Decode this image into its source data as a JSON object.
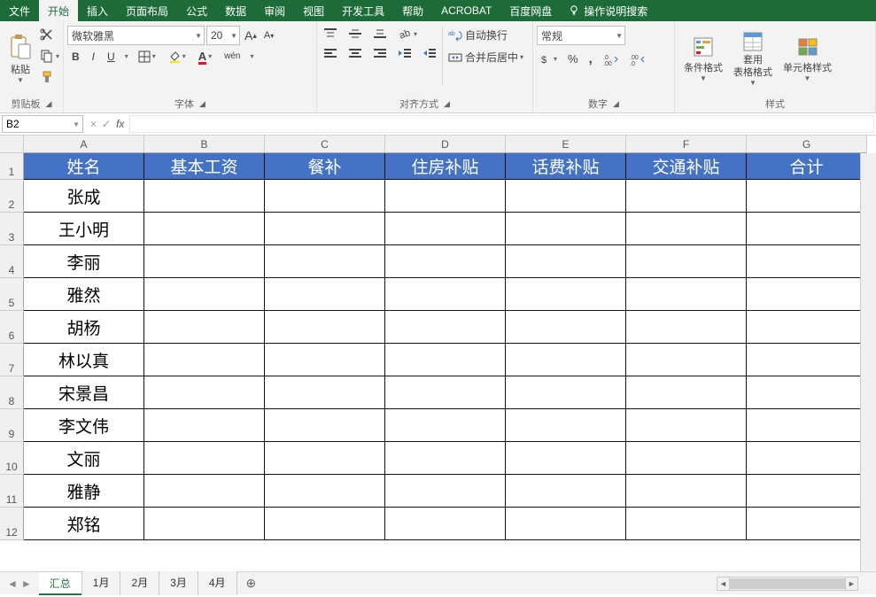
{
  "menu": {
    "tabs": [
      "文件",
      "开始",
      "插入",
      "页面布局",
      "公式",
      "数据",
      "审阅",
      "视图",
      "开发工具",
      "帮助",
      "ACROBAT",
      "百度网盘"
    ],
    "active_index": 1,
    "tell_me": "操作说明搜索"
  },
  "ribbon": {
    "clipboard": {
      "paste": "粘贴",
      "label": "剪贴板"
    },
    "font": {
      "name": "微软雅黑",
      "size": "20",
      "label": "字体",
      "bold": "B",
      "italic": "I",
      "underline": "U",
      "wen": "wén"
    },
    "alignment": {
      "wrap": "自动换行",
      "merge": "合并后居中",
      "label": "对齐方式"
    },
    "number": {
      "format": "常规",
      "label": "数字"
    },
    "styles": {
      "conditional": "条件格式",
      "format_table": "套用\n表格格式",
      "cell_styles": "单元格样式",
      "label": "样式"
    }
  },
  "formula_bar": {
    "name_box": "B2",
    "cancel": "×",
    "confirm": "✓",
    "fx": "fx",
    "content": ""
  },
  "sheet": {
    "columns": [
      "A",
      "B",
      "C",
      "D",
      "E",
      "F",
      "G"
    ],
    "row_numbers": [
      "1",
      "2",
      "3",
      "4",
      "5",
      "6",
      "7",
      "8",
      "9",
      "10",
      "11",
      "12"
    ],
    "headers": [
      "姓名",
      "基本工资",
      "餐补",
      "住房补贴",
      "话费补贴",
      "交通补贴",
      "合计"
    ],
    "rows": [
      [
        "张成",
        "",
        "",
        "",
        "",
        "",
        ""
      ],
      [
        "王小明",
        "",
        "",
        "",
        "",
        "",
        ""
      ],
      [
        "李丽",
        "",
        "",
        "",
        "",
        "",
        ""
      ],
      [
        "雅然",
        "",
        "",
        "",
        "",
        "",
        ""
      ],
      [
        "胡杨",
        "",
        "",
        "",
        "",
        "",
        ""
      ],
      [
        "林以真",
        "",
        "",
        "",
        "",
        "",
        ""
      ],
      [
        "宋景昌",
        "",
        "",
        "",
        "",
        "",
        ""
      ],
      [
        "李文伟",
        "",
        "",
        "",
        "",
        "",
        ""
      ],
      [
        "文丽",
        "",
        "",
        "",
        "",
        "",
        ""
      ],
      [
        "雅静",
        "",
        "",
        "",
        "",
        "",
        ""
      ],
      [
        "郑铭",
        "",
        "",
        "",
        "",
        "",
        ""
      ]
    ]
  },
  "tabs": {
    "items": [
      "汇总",
      "1月",
      "2月",
      "3月",
      "4月"
    ],
    "active_index": 0,
    "nav_prev": "◄",
    "nav_next": "►",
    "new": "⊕"
  }
}
